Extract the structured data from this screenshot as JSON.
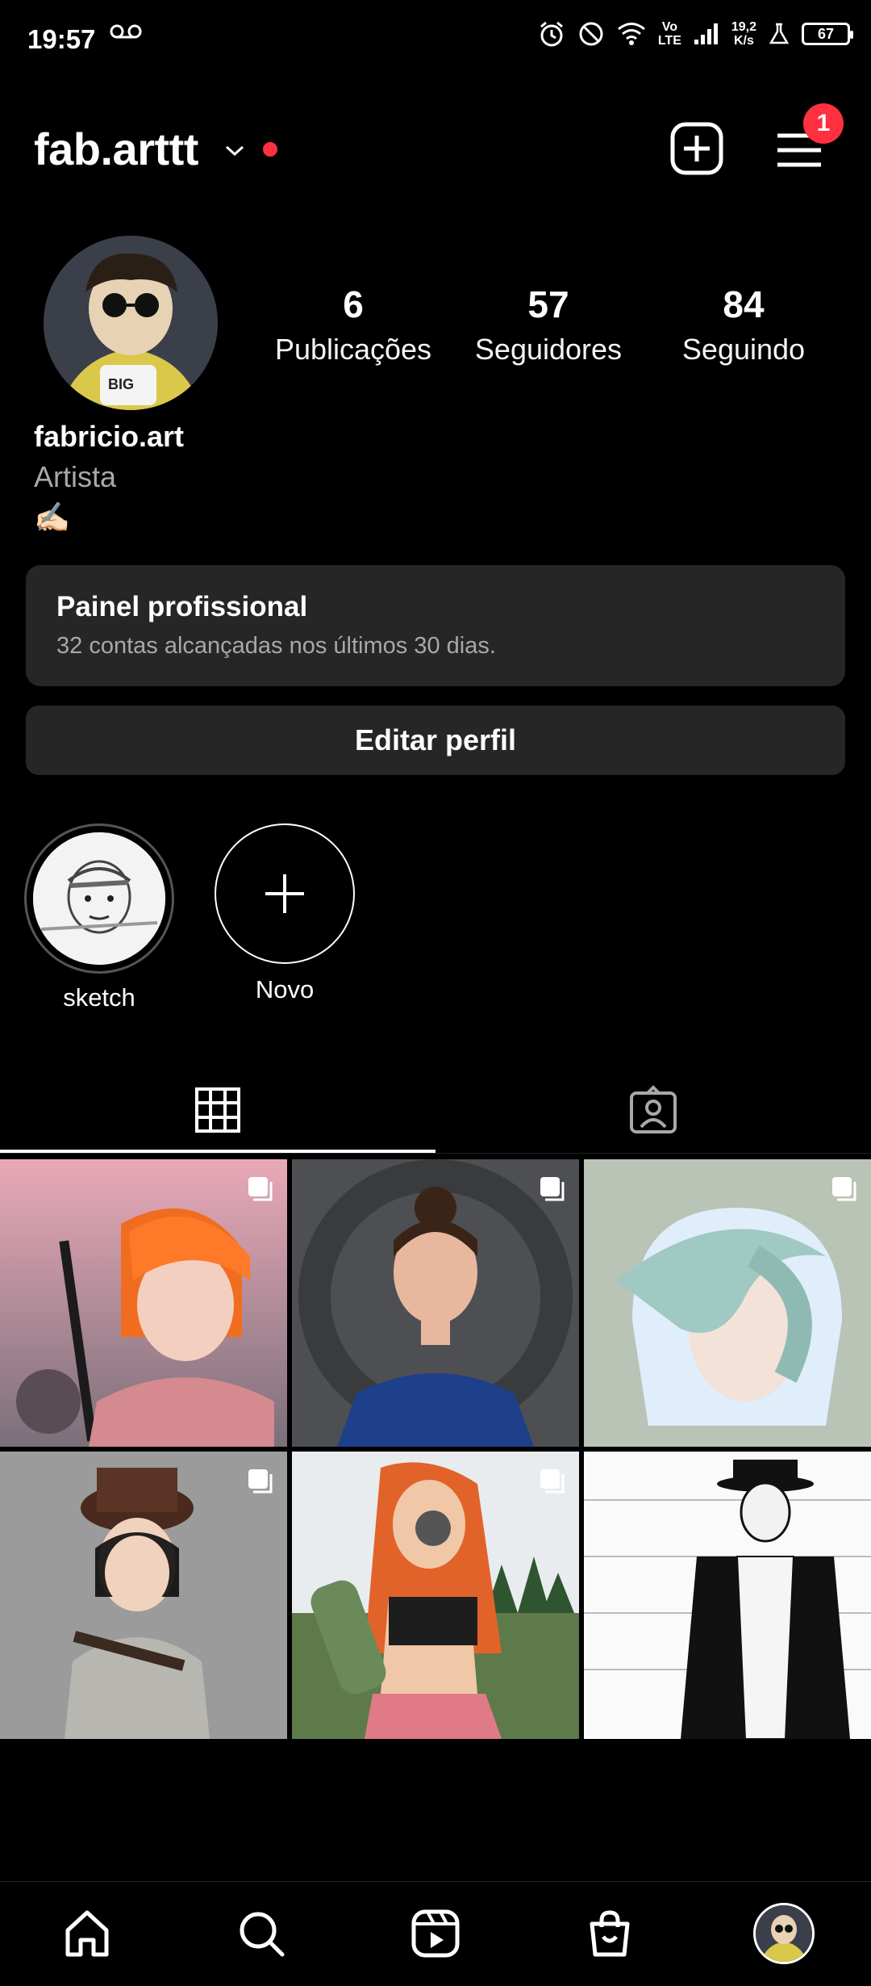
{
  "status_bar": {
    "time": "19:57",
    "net_speed_top": "19,2",
    "net_speed_bottom": "K/s",
    "volte_top": "Vo",
    "volte_bottom": "LTE",
    "battery": "67"
  },
  "header": {
    "username": "fab.arttt",
    "notification_count": "1"
  },
  "profile": {
    "posts_count": "6",
    "posts_label": "Publicações",
    "followers_count": "57",
    "followers_label": "Seguidores",
    "following_count": "84",
    "following_label": "Seguindo",
    "full_name": "fabricio.art",
    "category": "Artista",
    "bio_emoji": "✍🏻"
  },
  "dashboard": {
    "title": "Painel profissional",
    "subtitle": "32 contas alcançadas nos últimos 30 dias."
  },
  "edit_profile_label": "Editar perfil",
  "highlights": [
    {
      "label": "sketch"
    },
    {
      "label": "Novo"
    }
  ],
  "tabs": [
    "grid-icon",
    "tagged-icon"
  ],
  "bottom_nav": [
    "home-icon",
    "search-icon",
    "reels-icon",
    "shop-icon",
    "profile-avatar"
  ],
  "colors": {
    "accent_red": "#ff3040",
    "card_bg": "#262626",
    "secondary_text": "#a8a8a8"
  }
}
